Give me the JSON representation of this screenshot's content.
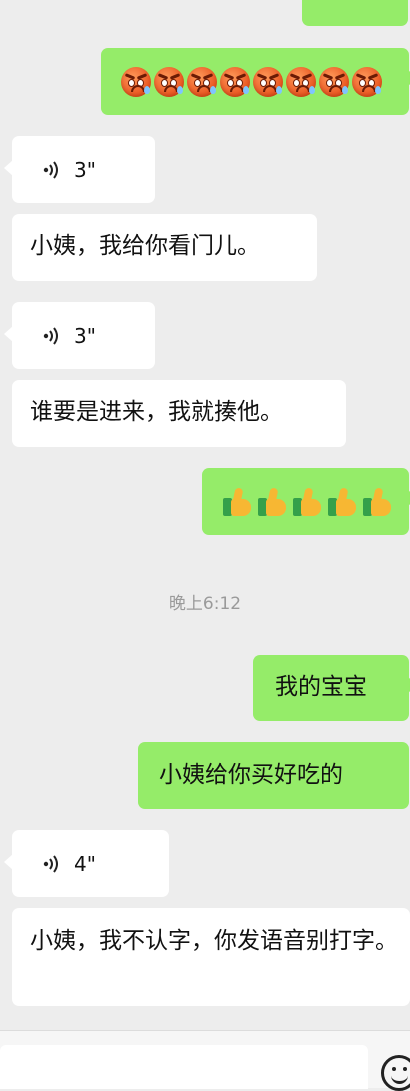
{
  "messages": [
    {
      "id": "m1",
      "side": "right",
      "type": "emoji",
      "emoji": "angry-face",
      "count": 8
    },
    {
      "id": "m2",
      "side": "left",
      "type": "voice",
      "duration": "3\""
    },
    {
      "id": "m3",
      "side": "left",
      "type": "text",
      "text": "小姨，我给你看门儿。"
    },
    {
      "id": "m4",
      "side": "left",
      "type": "voice",
      "duration": "3\""
    },
    {
      "id": "m5",
      "side": "left",
      "type": "text",
      "text": "谁要是进来，我就揍他。"
    },
    {
      "id": "m6",
      "side": "right",
      "type": "emoji",
      "emoji": "thumbs-up",
      "count": 5
    },
    {
      "id": "m7",
      "side": "right",
      "type": "text",
      "text": "我的宝宝"
    },
    {
      "id": "m8",
      "side": "right",
      "type": "text",
      "text": "小姨给你买好吃的"
    },
    {
      "id": "m9",
      "side": "left",
      "type": "voice",
      "duration": "4\""
    },
    {
      "id": "m10",
      "side": "left",
      "type": "text",
      "text": "小姨，我不认字，你发语音别打字。"
    }
  ],
  "timestamp": "晚上6:12",
  "colors": {
    "outgoing": "#95ec69",
    "incoming": "#ffffff",
    "background": "#ededed"
  },
  "icons": {
    "voice": "voice-wave-icon",
    "emoji_panel": "smiley-icon"
  }
}
